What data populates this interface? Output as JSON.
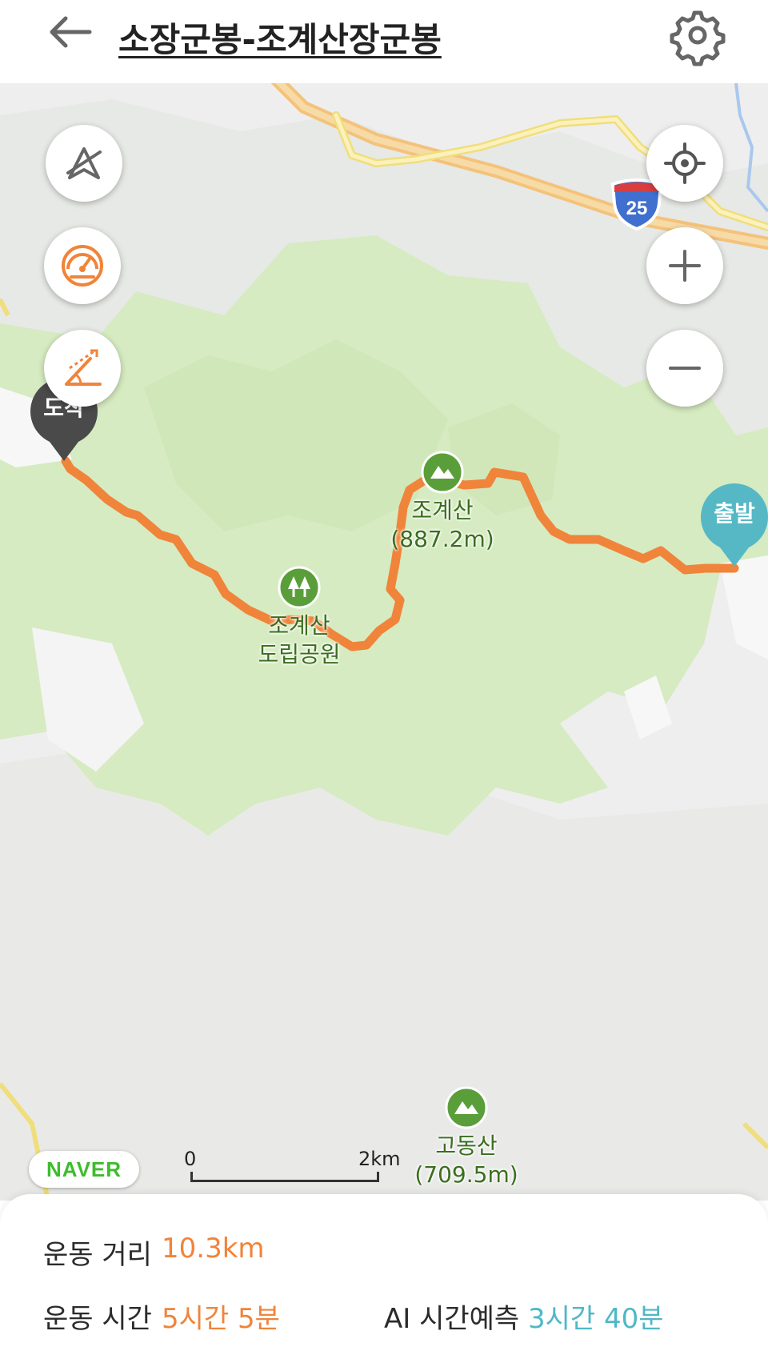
{
  "header": {
    "title": "소장군봉-조계산장군봉",
    "back_icon": "arrow-left-icon",
    "settings_icon": "gear-icon"
  },
  "map": {
    "highway_shield": "25",
    "peaks": [
      {
        "name": "조계산",
        "elevation": "(887.2m)",
        "icon": "mountain-icon"
      },
      {
        "name": "고동산",
        "elevation": "(709.5m)",
        "icon": "mountain-icon"
      }
    ],
    "park": {
      "line1": "조계산",
      "line2": "도립공원",
      "icon": "tree-icon"
    },
    "start_marker": {
      "label": "출발",
      "color": "#55b8c4"
    },
    "end_marker": {
      "label": "도착",
      "color": "#4a4a4a"
    },
    "route_color": "#f0843a",
    "scale": {
      "start": "0",
      "end": "2km"
    },
    "provider": "NAVER",
    "left_controls": [
      "compass-off-icon",
      "speedometer-icon",
      "slope-icon"
    ],
    "right_controls": [
      "locate-icon",
      "zoom-in-icon",
      "zoom-out-icon"
    ]
  },
  "stats": {
    "distance_label": "운동 거리",
    "distance_value": "10.3km",
    "time_label": "운동 시간",
    "time_value": "5시간 5분",
    "ai_label": "AI 시간예측",
    "ai_value": "3시간 40분",
    "accent_orange": "#f0843a",
    "accent_teal": "#4fb8c6"
  }
}
